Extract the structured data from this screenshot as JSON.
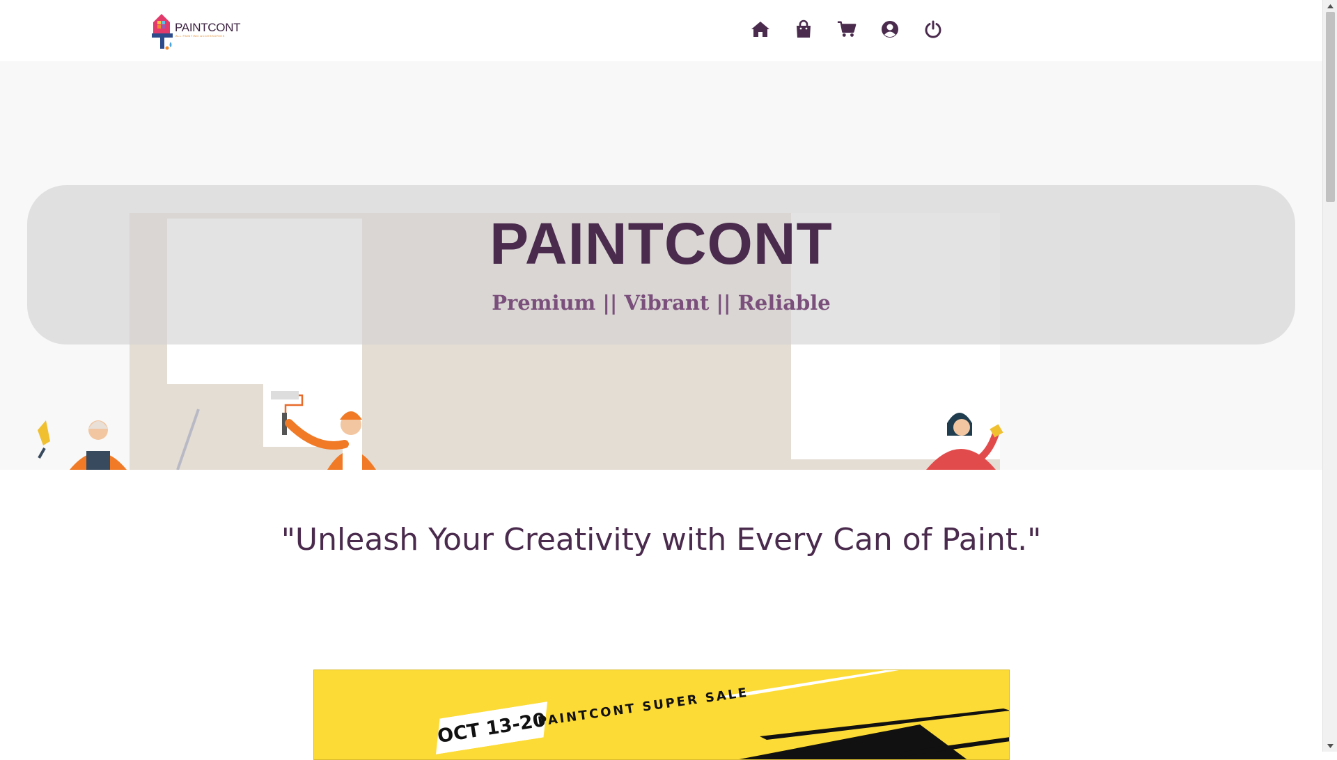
{
  "brand": {
    "name": "PAINTCONT",
    "tagline_small": "ALL PAINTING ACCESSORIES"
  },
  "nav": {
    "icons": [
      {
        "name": "home-icon"
      },
      {
        "name": "shopping-bag-icon"
      },
      {
        "name": "cart-icon"
      },
      {
        "name": "user-circle-icon"
      },
      {
        "name": "power-icon"
      }
    ]
  },
  "hero": {
    "title": "PAINTCONT",
    "subtitle": "Premium || Vibrant || Reliable"
  },
  "tagline": "\"Unleash Your Creativity with Every Can of Paint.\"",
  "sale": {
    "date": "OCT 13-20",
    "title": "PAINTCONT SUPER SALE"
  },
  "colors": {
    "primary": "#4a2a4d",
    "secondary": "#7a4f7b",
    "sale_bg": "#fddb36",
    "hero_bg": "#f8f8f8"
  }
}
